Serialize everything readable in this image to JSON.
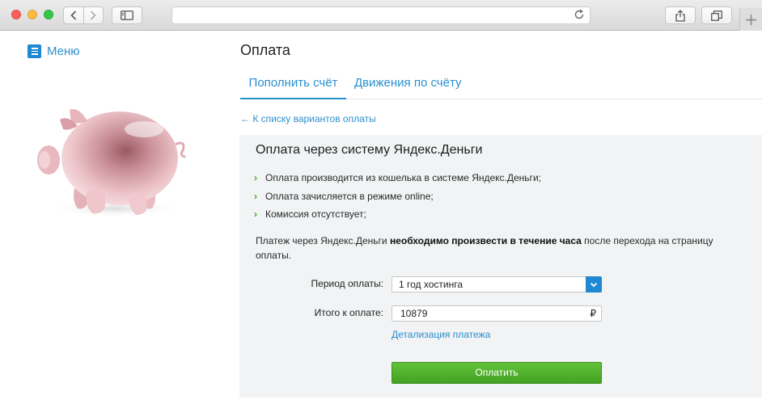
{
  "browser": {
    "new_tab_symbol": "+",
    "icons": [
      "back-chevron-icon",
      "forward-chevron-icon",
      "sidebar-icon",
      "reload-icon",
      "share-icon",
      "tabs-overview-icon"
    ]
  },
  "menu": {
    "label": "Меню",
    "icon": "hamburger-icon"
  },
  "hero": {
    "image": "piggy-bank"
  },
  "page": {
    "title": "Оплата"
  },
  "tabs": [
    {
      "label": "Пополнить счёт",
      "active": true
    },
    {
      "label": "Движения по счёту",
      "active": false
    }
  ],
  "back_link": "← К списку вариантов оплаты",
  "panel": {
    "title": "Оплата через систему Яндекс.Деньги",
    "bullet_marker": "›",
    "bullets": [
      "Оплата производится из кошелька в системе Яндекс.Деньги;",
      "Оплата зачисляется в режиме online;",
      "Комиссия отсутствует;"
    ],
    "notice": {
      "before": "Платеж через Яндекс.Деньги ",
      "bold": "необходимо произвести в течение часа",
      "after": " после перехода на страницу оплаты."
    }
  },
  "form": {
    "period_label": "Период оплаты:",
    "period_value": "1 год хостинга",
    "total_label": "Итого к оплате:",
    "total_value": "10879",
    "currency": "₽",
    "details_link": "Детализация платежа",
    "pay_button": "Оплатить"
  },
  "colors": {
    "link": "#2a8fd0",
    "accent_blue": "#1e88d2",
    "pay_green": "#52b32e",
    "panel_bg": "#f1f3f4"
  }
}
